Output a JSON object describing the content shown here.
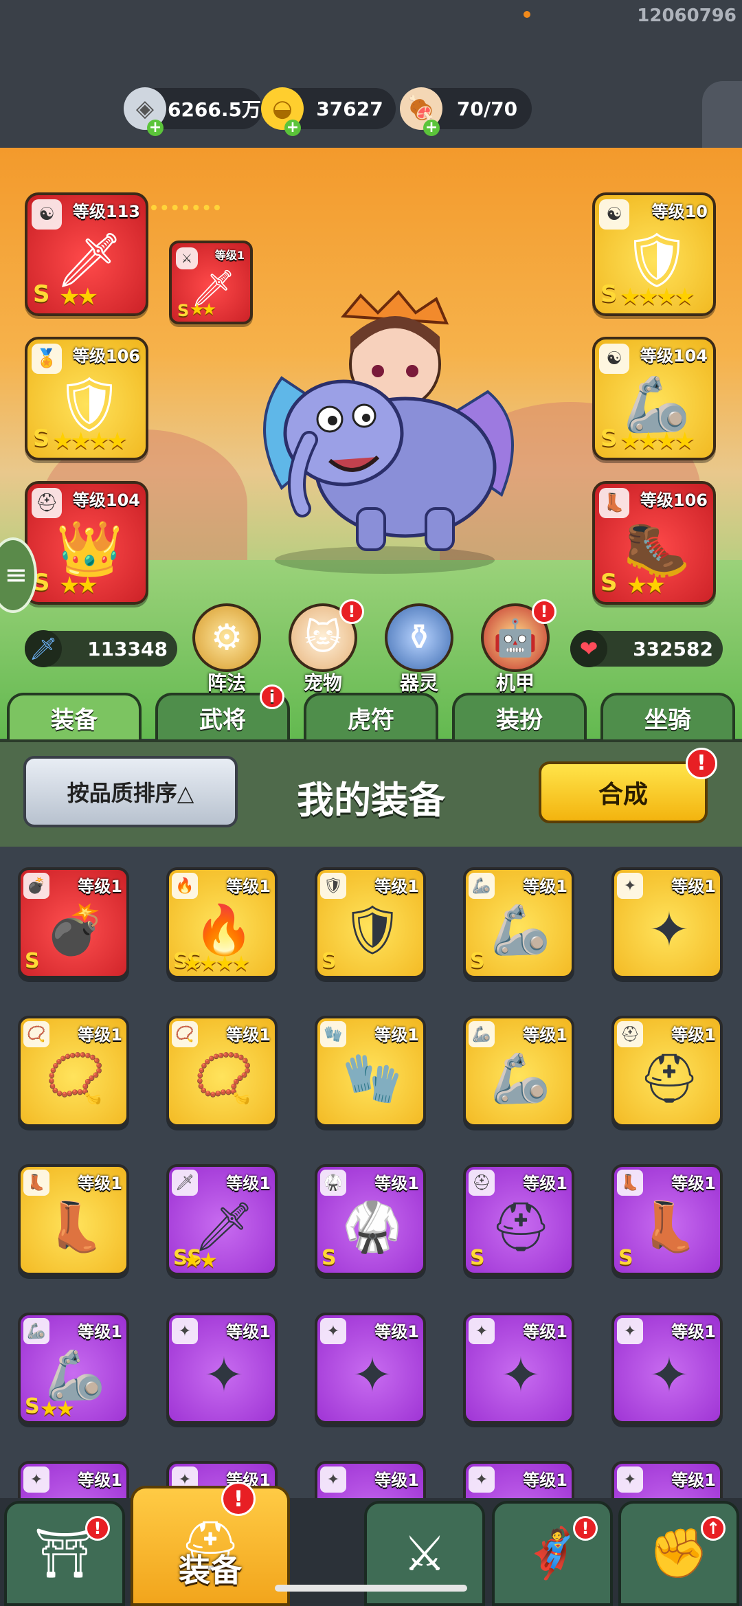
{
  "build_id": "12060796",
  "resources": [
    {
      "name": "silver",
      "icon": "silver-coin-icon",
      "value": "6266.5万"
    },
    {
      "name": "gold",
      "icon": "gold-ingot-icon",
      "value": "37627"
    },
    {
      "name": "stamina",
      "icon": "meat-icon",
      "value": "70/70"
    }
  ],
  "hero": {
    "left_slots": [
      {
        "type_icon": "taiji-icon",
        "level": "等级113",
        "grade": "S",
        "stars": "★★",
        "color": "red"
      },
      {
        "type_icon": "medal-icon",
        "level": "等级106",
        "grade": "S",
        "stars": "★★★★",
        "color": "gold"
      },
      {
        "type_icon": "helmet-icon",
        "level": "等级104",
        "grade": "S",
        "stars": "★★",
        "color": "red"
      }
    ],
    "weapon_slot": {
      "type_icon": "sword-icon",
      "level": "等级1",
      "grade": "S",
      "stars": "★★",
      "color": "red"
    },
    "right_slots": [
      {
        "type_icon": "taiji-icon",
        "level": "等级10",
        "grade": "S",
        "stars": "★★★★",
        "color": "gold"
      },
      {
        "type_icon": "taiji-icon",
        "level": "等级104",
        "grade": "S",
        "stars": "★★★★",
        "color": "gold"
      },
      {
        "type_icon": "boot-icon",
        "level": "等级106",
        "grade": "S",
        "stars": "★★",
        "color": "red"
      }
    ],
    "attack": "113348",
    "health": "332582",
    "skills": [
      {
        "label": "阵法",
        "icon": "formation-icon",
        "badge": false
      },
      {
        "label": "宠物",
        "icon": "pet-cat-icon",
        "badge": true
      },
      {
        "label": "器灵",
        "icon": "spirit-icon",
        "badge": false
      },
      {
        "label": "机甲",
        "icon": "mecha-icon",
        "badge": true
      }
    ]
  },
  "tabs": [
    {
      "label": "装备",
      "active": true,
      "badge": false
    },
    {
      "label": "武将",
      "active": false,
      "badge": true
    },
    {
      "label": "虎符",
      "active": false,
      "badge": false
    },
    {
      "label": "装扮",
      "active": false,
      "badge": false
    },
    {
      "label": "坐骑",
      "active": false,
      "badge": false
    }
  ],
  "panel": {
    "sort_label": "按品质排序△",
    "title": "我的装备",
    "combine_label": "合成"
  },
  "items": [
    {
      "level": "等级1",
      "color": "red",
      "grade": "S",
      "stars": "",
      "icon": "bomb-icon"
    },
    {
      "level": "等级1",
      "color": "gold",
      "grade": "SS",
      "stars": "★★★★",
      "icon": "phoenix-icon"
    },
    {
      "level": "等级1",
      "color": "gold",
      "grade": "S",
      "stars": "",
      "icon": "armor-icon"
    },
    {
      "level": "等级1",
      "color": "gold",
      "grade": "S",
      "stars": "",
      "icon": "bracer-icon"
    },
    {
      "level": "等级1",
      "color": "gold",
      "grade": "",
      "stars": "",
      "icon": "shuriken-icon"
    },
    {
      "level": "等级1",
      "color": "gold",
      "grade": "",
      "stars": "",
      "icon": "amulet-icon"
    },
    {
      "level": "等级1",
      "color": "gold",
      "grade": "",
      "stars": "",
      "icon": "necklace-icon"
    },
    {
      "level": "等级1",
      "color": "gold",
      "grade": "",
      "stars": "",
      "icon": "gauntlet-icon"
    },
    {
      "level": "等级1",
      "color": "gold",
      "grade": "",
      "stars": "",
      "icon": "bracer-icon"
    },
    {
      "level": "等级1",
      "color": "gold",
      "grade": "",
      "stars": "",
      "icon": "helmet-icon"
    },
    {
      "level": "等级1",
      "color": "gold",
      "grade": "",
      "stars": "",
      "icon": "boot-icon"
    },
    {
      "level": "等级1",
      "color": "purple",
      "grade": "SS",
      "stars": "★★",
      "icon": "sword-icon"
    },
    {
      "level": "等级1",
      "color": "purple",
      "grade": "S",
      "stars": "",
      "icon": "chest-armor-icon"
    },
    {
      "level": "等级1",
      "color": "purple",
      "grade": "S",
      "stars": "",
      "icon": "helmet-icon"
    },
    {
      "level": "等级1",
      "color": "purple",
      "grade": "S",
      "stars": "",
      "icon": "boot-icon"
    },
    {
      "level": "等级1",
      "color": "purple",
      "grade": "S",
      "stars": "★★",
      "icon": "bracer-icon"
    },
    {
      "level": "等级1",
      "color": "purple",
      "grade": "",
      "stars": "",
      "icon": "shuriken-icon"
    },
    {
      "level": "等级1",
      "color": "purple",
      "grade": "",
      "stars": "",
      "icon": "shuriken-icon"
    },
    {
      "level": "等级1",
      "color": "purple",
      "grade": "",
      "stars": "",
      "icon": "shuriken-icon"
    },
    {
      "level": "等级1",
      "color": "purple",
      "grade": "",
      "stars": "",
      "icon": "shuriken-icon"
    },
    {
      "level": "等级1",
      "color": "purple",
      "grade": "",
      "stars": "",
      "icon": "shuriken-icon"
    },
    {
      "level": "等级1",
      "color": "purple",
      "grade": "",
      "stars": "",
      "icon": "shuriken-icon"
    },
    {
      "level": "等级1",
      "color": "purple",
      "grade": "",
      "stars": "",
      "icon": "shuriken-icon"
    },
    {
      "level": "等级1",
      "color": "purple",
      "grade": "",
      "stars": "",
      "icon": "shuriken-icon"
    },
    {
      "level": "等级1",
      "color": "purple",
      "grade": "",
      "stars": "",
      "icon": "shuriken-icon"
    }
  ],
  "bottom_nav": [
    {
      "name": "city",
      "icon": "gate-icon",
      "label": "",
      "active": false,
      "badge": "!"
    },
    {
      "name": "equipment",
      "icon": "helmet-icon",
      "label": "装备",
      "active": true,
      "badge": "!"
    },
    {
      "name": "battle",
      "icon": "crossed-swords-icon",
      "label": "",
      "active": false,
      "badge": ""
    },
    {
      "name": "heroes",
      "icon": "hero-icon",
      "label": "",
      "active": false,
      "badge": "!"
    },
    {
      "name": "upgrade",
      "icon": "fist-icon",
      "label": "",
      "active": false,
      "badge": "↑"
    }
  ]
}
